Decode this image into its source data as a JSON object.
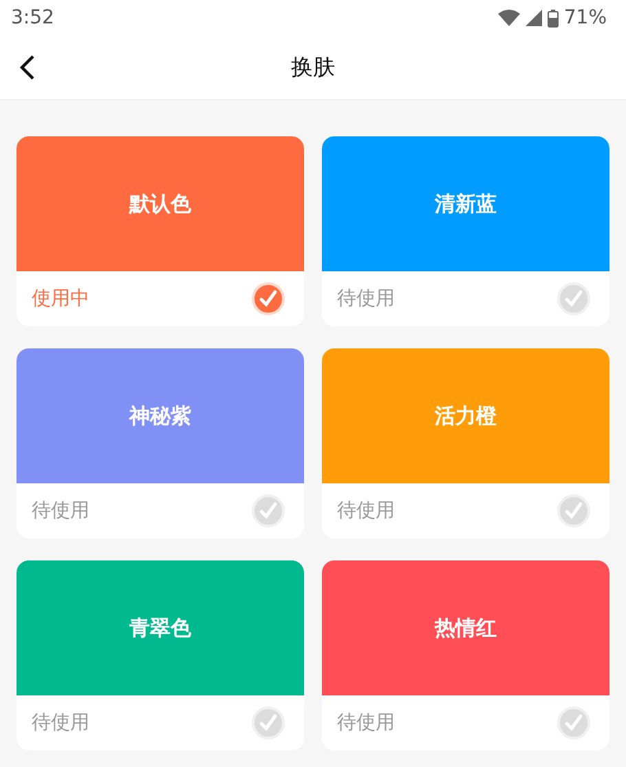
{
  "status_bar": {
    "time": "3:52",
    "battery": "71%"
  },
  "header": {
    "title": "换肤"
  },
  "skins": [
    {
      "name": "默认色",
      "color": "#ff6b40",
      "status": "使用中",
      "selected": true
    },
    {
      "name": "清新蓝",
      "color": "#009cff",
      "status": "待使用",
      "selected": false
    },
    {
      "name": "神秘紫",
      "color": "#8190f5",
      "status": "待使用",
      "selected": false
    },
    {
      "name": "活力橙",
      "color": "#ff9c0a",
      "status": "待使用",
      "selected": false
    },
    {
      "name": "青翠色",
      "color": "#00b98e",
      "status": "待使用",
      "selected": false
    },
    {
      "name": "热情红",
      "color": "#ff4e55",
      "status": "待使用",
      "selected": false
    }
  ]
}
